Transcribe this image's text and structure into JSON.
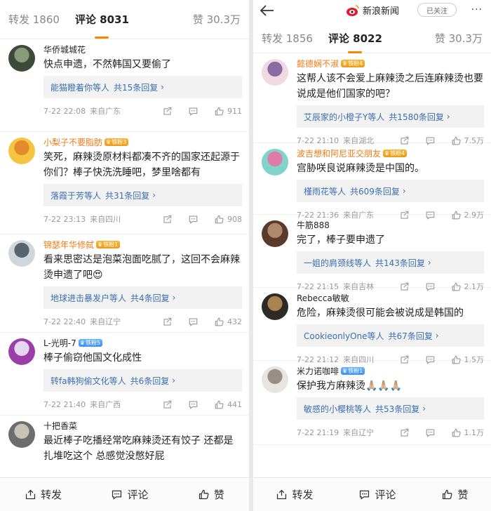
{
  "left": {
    "tabs": {
      "reposts": "转发 1860",
      "comments": "评论 8031",
      "likes": "赞 30.3万"
    },
    "comments": [
      {
        "user": "华侨城城花",
        "vip": false,
        "badge": "",
        "text": "快点申遗，不然韩国又要偷了",
        "reply_users": "能猫瞪着你等人",
        "reply_count": "共15条回复",
        "time": "7-22 22:08",
        "location": "来自广东",
        "likes": "911"
      },
      {
        "user": "小梨子不要脂肪",
        "vip": true,
        "badge": "铁粉3",
        "text": "笑死，麻辣烫原材料都凑不齐的国家还起源于你们？棒子快洗洗睡吧，梦里啥都有",
        "reply_users": "落霞于芳等人",
        "reply_count": "共31条回复",
        "time": "7-22 23:13",
        "location": "来自四川",
        "likes": "908"
      },
      {
        "user": "锦瑟年华修弑",
        "vip": true,
        "badge": "铁粉1",
        "text": "看来思密达是泡菜泡面吃腻了，这回不会麻辣烫申遗了吧😍",
        "reply_users": "地球进击暴发户等人",
        "reply_count": "共4条回复",
        "time": "7-22 22:40",
        "location": "来自辽宁",
        "likes": "432"
      },
      {
        "user": "L-光明-7",
        "vip": false,
        "badge": "铁粉5",
        "text": "棒子偷窃他国文化成性",
        "reply_users": "转fa韩狗偷文化等人",
        "reply_count": "共6条回复",
        "time": "7-22 21:40",
        "location": "来自广西",
        "likes": "441"
      },
      {
        "user": "十把香菜",
        "vip": false,
        "badge": "",
        "text": "最近棒子吃播经常吃麻辣烫还有饺子 还都是扎堆吃这个 总感觉没憋好屁",
        "reply_users": "",
        "reply_count": "",
        "time": "",
        "location": "",
        "likes": ""
      }
    ],
    "bottom": {
      "repost": "转发",
      "comment": "评论",
      "like": "赞"
    }
  },
  "right": {
    "header": {
      "account": "新浪新闻",
      "follow": "已关注",
      "more": "···"
    },
    "tabs": {
      "reposts": "转发 1856",
      "comments": "评论 8022",
      "likes": "赞 30.3万"
    },
    "comments": [
      {
        "user": "懿德娴不淑",
        "vip": true,
        "badge": "铁粉4",
        "text": "这帮人该不会爱上麻辣烫之后连麻辣烫也要说成是他们国家的吧？",
        "reply_users": "艾辰家的小橙子Y等人",
        "reply_count": "共1580条回复",
        "time": "7-22 21:10",
        "location": "来自湖北",
        "likes": "7.5万"
      },
      {
        "user": "波吉想和阿尼亚交朋友",
        "vip": true,
        "badge": "铁粉4",
        "text": "宫胁咲良说麻辣烫是中国的。",
        "reply_users": "槿雨花等人",
        "reply_count": "共609条回复",
        "time": "7-22 21:36",
        "location": "来自广东",
        "likes": "2.9万"
      },
      {
        "user": "牛筋888",
        "vip": false,
        "badge": "",
        "text": "完了，棒子要申遗了",
        "reply_users": "一姐的肩颈线等人",
        "reply_count": "共143条回复",
        "time": "7-22 21:15",
        "location": "来自吉林",
        "likes": "2.1万"
      },
      {
        "user": "Rebecca敏敏",
        "vip": false,
        "badge": "",
        "text": "危险，麻辣烫很可能会被说成是韩国的",
        "reply_users": "CookieonlyOne等人",
        "reply_count": "共67条回复",
        "time": "7-22 21:12",
        "location": "来自四川",
        "likes": "1.5万"
      },
      {
        "user": "米力诺咖啡",
        "vip": false,
        "badge": "铁粉1",
        "text": "保护我方麻辣烫🙏🏼🙏🏼🙏🏼",
        "reply_users": "敏感的小樱桃等人",
        "reply_count": "共53条回复",
        "time": "7-22 21:19",
        "location": "来自辽宁",
        "likes": "1.1万"
      }
    ],
    "bottom": {
      "repost": "转发",
      "comment": "评论",
      "like": "赞"
    }
  },
  "colors": {
    "accent": "#ff8200",
    "link": "#3b6fb0",
    "vip_name": "#f27a16"
  },
  "icons": [
    "back-arrow-icon",
    "sina-logo-icon",
    "share-icon",
    "comment-icon",
    "like-icon"
  ]
}
